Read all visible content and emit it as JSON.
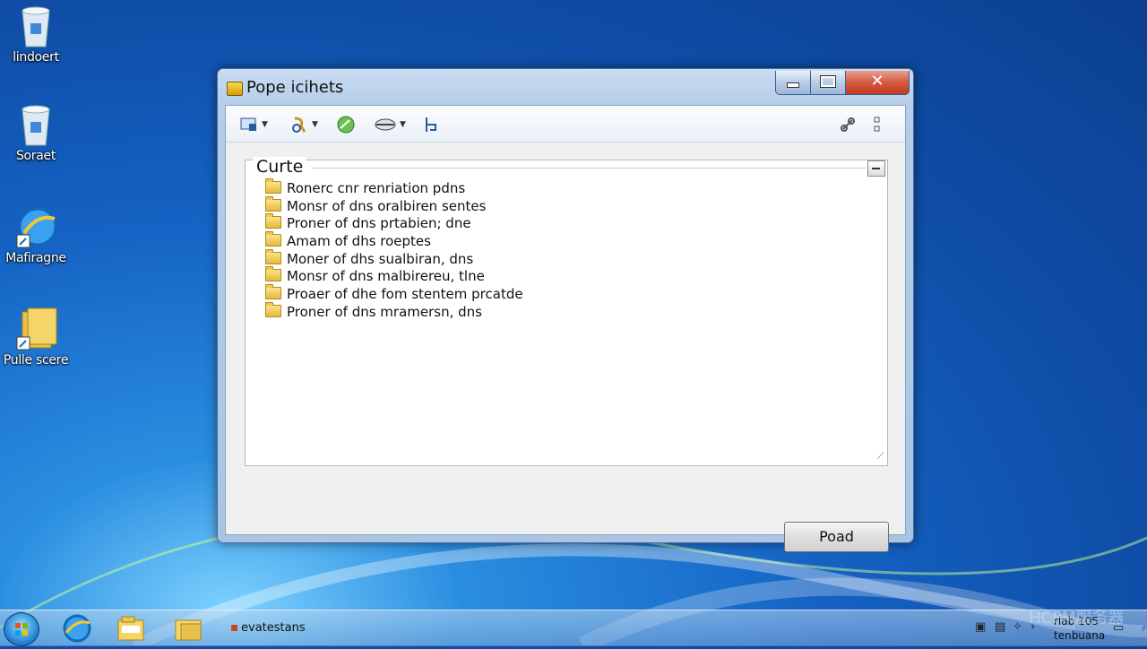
{
  "desktop": {
    "icons": [
      {
        "label": "lindoert",
        "icon": "recycle-bin-icon"
      },
      {
        "label": "Soraet",
        "icon": "recycle-bin-icon"
      },
      {
        "label": "Mafiragne",
        "icon": "internet-explorer-icon"
      },
      {
        "label": "Pulle scere",
        "icon": "folder-shortcut-icon"
      }
    ]
  },
  "window": {
    "title": "Pope icihets",
    "toolbar": {
      "buttons": [
        {
          "icon": "view-icon",
          "has_dropdown": true
        },
        {
          "icon": "tools-icon",
          "has_dropdown": true
        },
        {
          "icon": "globe-icon",
          "has_dropdown": false
        },
        {
          "icon": "network-icon",
          "has_dropdown": true
        },
        {
          "icon": "paint-icon",
          "has_dropdown": false
        }
      ],
      "right_buttons": [
        {
          "icon": "link-icon"
        },
        {
          "icon": "more-icon"
        }
      ]
    },
    "group": {
      "title": "Curte",
      "items": [
        "Ronerc cnr renriation pdns",
        "Monsr of dns oralbiren sentes",
        "Proner of dns prtabien; dne",
        "Amam of dhs roeptes",
        "Moner of dhs sualbiran, dns",
        "Monsr of dns malbirereu, tlne",
        "Proaer of dhe fom stentem prcatde",
        "Proner of dns mramersn, dns"
      ]
    },
    "action_button": "Poad"
  },
  "taskbar": {
    "active_task": "evatestans",
    "clock_line1": "rlab 105",
    "clock_line2": "tenbuana",
    "watermark": "HCPM服务器"
  },
  "colors": {
    "desktop": "#1563c4",
    "close_button": "#c23a20",
    "folder": "#e6b93a"
  }
}
